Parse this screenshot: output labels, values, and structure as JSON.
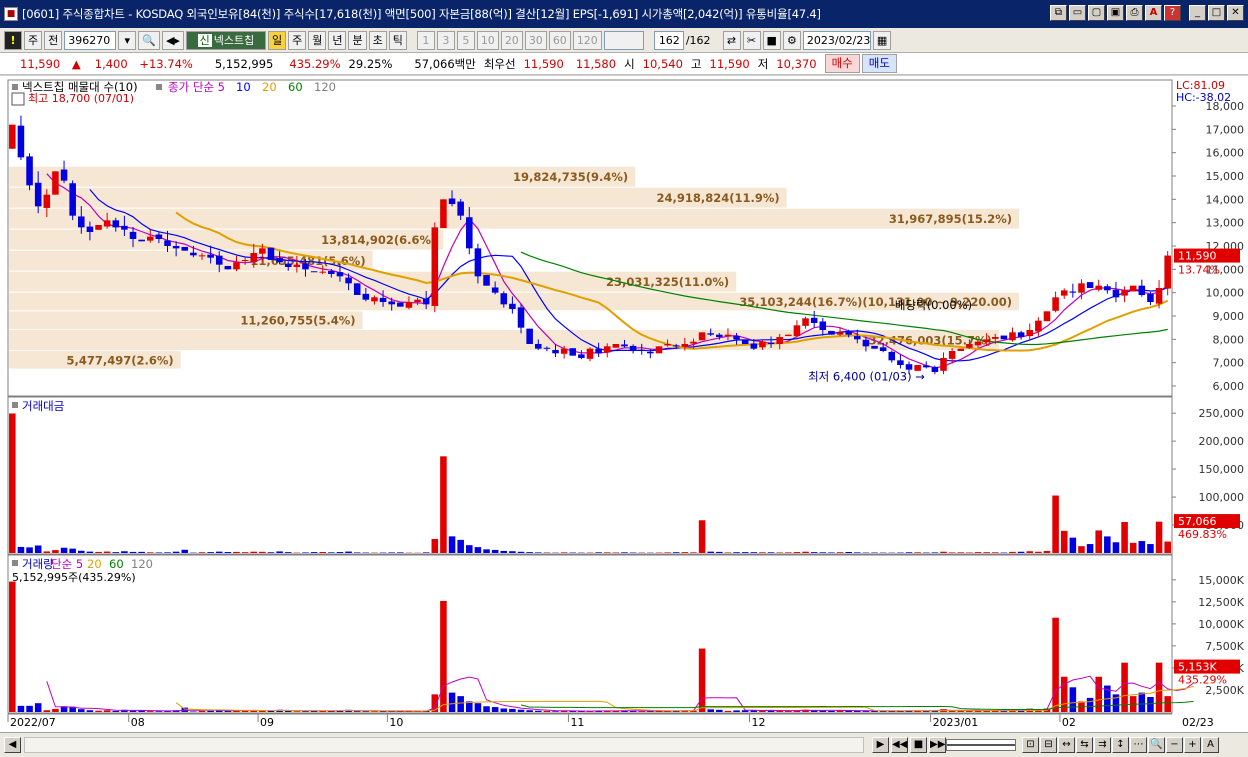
{
  "window": {
    "title": "[0601] 주식종합차트 - KOSDAQ 외국인보유[84(천)] 주식수[17,618(천)] 액면[500] 자본금[88(억)] 결산[12월] EPS[-1,691] 시가총액[2,042(억)] 유통비율[47.4]"
  },
  "toolbar": {
    "market": "주",
    "prev": "전",
    "code": "396270",
    "name": "넥스트칩",
    "periods": [
      "일",
      "주",
      "월",
      "년",
      "분",
      "초",
      "틱"
    ],
    "minutes": [
      "1",
      "3",
      "5",
      "10",
      "20",
      "30",
      "60",
      "120"
    ],
    "count": "162",
    "total": "/162",
    "date": "2023/02/23"
  },
  "quote": {
    "price": "11,590",
    "change": "1,400",
    "change_pct": "+13.74%",
    "volume": "5,152,995",
    "vol_ratio": "435.29%",
    "turnover": "29.25%",
    "amount": "57,066백만",
    "best_label": "최우선",
    "ask": "11,590",
    "bid": "11,580",
    "open_label": "시",
    "open": "10,540",
    "high_label": "고",
    "high": "11,590",
    "low_label": "저",
    "low": "10,370",
    "buy": "매수",
    "sell": "매도"
  },
  "chart_data": [
    {
      "type": "candlestick",
      "title": "넥스트칩 매물대 수(10)",
      "ma_legend": [
        "종가 단순 5",
        "10",
        "20",
        "60",
        "120"
      ],
      "ma_colors": [
        "#c000c0",
        "#0000ff",
        "#e0a000",
        "#008000",
        "#808080"
      ],
      "ylim": [
        6000,
        18000
      ],
      "yticks": [
        "18,000",
        "17,000",
        "16,000",
        "15,000",
        "14,000",
        "13,000",
        "12,000",
        "11,000",
        "10,000",
        "9,000",
        "8,000",
        "7,000",
        "6,000"
      ],
      "header_right": [
        "LC:81.09",
        "HC:-38.02"
      ],
      "price_tag": "11,590",
      "pct_tag": "13.74%",
      "annotations": {
        "high": "최고 18,700 (07/01)",
        "low": "최저 6,400 (01/03)",
        "dividend": "배당락(0.00%)"
      },
      "volume_profile": [
        {
          "label": "31,967,895(15.2%)",
          "price_lo": 12700,
          "price_hi": 13600,
          "frac": 1.0
        },
        {
          "label": "24,918,824(11.9%)",
          "price_lo": 13600,
          "price_hi": 14500,
          "frac": 0.77
        },
        {
          "label": "19,824,735(9.4%)",
          "price_lo": 14500,
          "price_hi": 15400,
          "frac": 0.62
        },
        {
          "label": "13,814,902(6.6%)",
          "price_lo": 11800,
          "price_hi": 12700,
          "frac": 0.43
        },
        {
          "label": "11,655,481(5.6%)",
          "price_lo": 10900,
          "price_hi": 11800,
          "frac": 0.36
        },
        {
          "label": "23,031,325(11.0%)",
          "price_lo": 10000,
          "price_hi": 10900,
          "frac": 0.72
        },
        {
          "label": "35,103,244(16.7%)(10,131.00 ~ 9,220.00)",
          "price_lo": 9200,
          "price_hi": 10000,
          "frac": 1.0
        },
        {
          "label": "11,260,755(5.4%)",
          "price_lo": 8400,
          "price_hi": 9200,
          "frac": 0.35
        },
        {
          "label": "32,476,003(15.7%)",
          "price_lo": 7500,
          "price_hi": 8400,
          "frac": 0.98
        },
        {
          "label": "5,477,497(2.6%)",
          "price_lo": 6700,
          "price_hi": 7500,
          "frac": 0.17
        }
      ]
    },
    {
      "type": "bar",
      "title": "거래대금",
      "ylim": [
        0,
        270000
      ],
      "yticks": [
        "250,000",
        "200,000",
        "150,000",
        "100,000",
        "50,000"
      ],
      "tag": "57,066",
      "tag2": "469.83%"
    },
    {
      "type": "bar",
      "title": "거래량",
      "ma_legend": [
        "단순 5",
        "20",
        "60",
        "120"
      ],
      "subtitle": "5,152,995주(435.29%)",
      "ylim": [
        0,
        16000
      ],
      "yticks": [
        "15,000K",
        "12,500K",
        "10,000K",
        "7,500K",
        "5,000K",
        "2,500K"
      ],
      "tag": "5,153K",
      "tag2": "435.29%"
    }
  ],
  "xaxis": {
    "labels": [
      "2022/07",
      "08",
      "09",
      "10",
      "11",
      "12",
      "2023/01",
      "02"
    ],
    "right_label": "02/23"
  },
  "series": {
    "close": [
      17200,
      15800,
      14600,
      13700,
      14200,
      15200,
      14800,
      13300,
      12800,
      12600,
      12900,
      13100,
      12800,
      12700,
      12300,
      12200,
      12400,
      12300,
      12000,
      11900,
      11800,
      11600,
      11600,
      11500,
      11200,
      11000,
      11300,
      11400,
      11700,
      11900,
      11400,
      11300,
      11100,
      11200,
      11000,
      10900,
      10900,
      10800,
      10700,
      10400,
      9900,
      9700,
      9800,
      9600,
      9500,
      9400,
      9600,
      9700,
      9500,
      12800,
      14000,
      13800,
      13300,
      11900,
      10700,
      10300,
      10000,
      9500,
      9300,
      8500,
      7800,
      7600,
      7600,
      7400,
      7600,
      7300,
      7200,
      7600,
      7400,
      7700,
      7800,
      7700,
      7500,
      7500,
      7400,
      7700,
      7800,
      7700,
      7800,
      7900,
      8300,
      8200,
      8100,
      8200,
      8000,
      7800,
      7600,
      7900,
      7800,
      8100,
      8200,
      8600,
      8900,
      8700,
      8400,
      8200,
      8300,
      8200,
      8000,
      7700,
      7600,
      7500,
      7100,
      6900,
      6700,
      6900,
      6800,
      6600,
      7200,
      7500,
      7600,
      7800,
      7900,
      8000,
      8100,
      8000,
      8300,
      8100,
      8400,
      8800,
      9200,
      9800,
      10100,
      10000,
      10400,
      10200,
      10300,
      10100,
      9800,
      10100,
      10300,
      9900,
      9600,
      10200,
      11590
    ],
    "volume": [
      14800,
      700,
      700,
      1000,
      200,
      350,
      650,
      600,
      320,
      200,
      150,
      200,
      120,
      250,
      160,
      170,
      100,
      80,
      100,
      200,
      500,
      60,
      120,
      140,
      220,
      160,
      180,
      130,
      200,
      180,
      120,
      250,
      140,
      60,
      90,
      150,
      170,
      110,
      160,
      250,
      100,
      80,
      70,
      80,
      110,
      120,
      60,
      50,
      120,
      2000,
      12600,
      2200,
      1800,
      1200,
      1000,
      650,
      560,
      400,
      350,
      260,
      200,
      140,
      120,
      80,
      150,
      110,
      90,
      100,
      170,
      150,
      120,
      160,
      110,
      100,
      80,
      100,
      140,
      180,
      200,
      150,
      7200,
      300,
      250,
      120,
      180,
      200,
      190,
      160,
      160,
      120,
      140,
      200,
      260,
      180,
      150,
      120,
      170,
      220,
      140,
      100,
      110,
      90,
      85,
      120,
      200,
      180,
      120,
      160,
      320,
      140,
      160,
      120,
      200,
      180,
      160,
      100,
      250,
      280,
      380,
      260,
      400,
      10700,
      4000,
      2800,
      1200,
      1600,
      4000,
      3000,
      2000,
      5600,
      1800,
      2200,
      1700,
      5600,
      1800,
      900,
      3000,
      5153
    ]
  }
}
